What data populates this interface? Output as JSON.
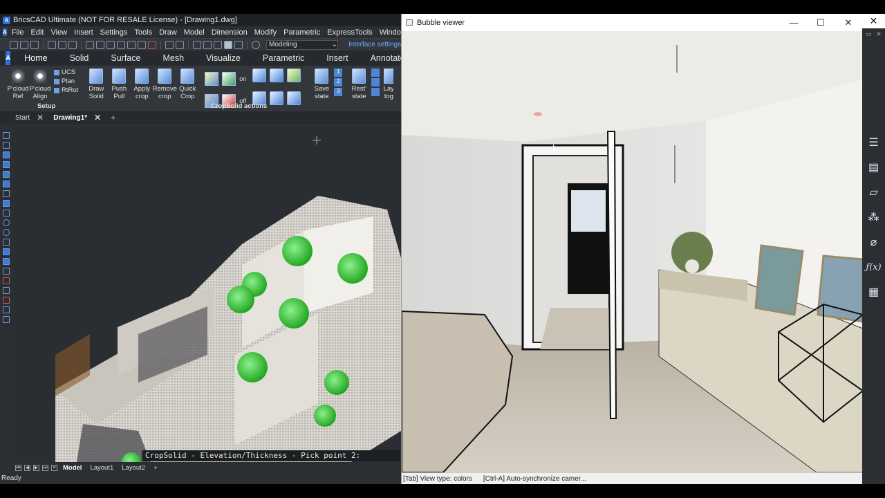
{
  "cad": {
    "title": "BricsCAD Ultimate (NOT FOR RESALE License) - [Drawing1.dwg]",
    "menu": [
      "File",
      "Edit",
      "View",
      "Insert",
      "Settings",
      "Tools",
      "Draw",
      "Model",
      "Dimension",
      "Modify",
      "Parametric",
      "ExpressTools",
      "Window"
    ],
    "workspace": "Modeling",
    "interface_settings": "Interface settings",
    "ribbon_tabs": [
      "Home",
      "Solid",
      "Surface",
      "Mesh",
      "Visualize",
      "Parametric",
      "Insert",
      "Annotate"
    ],
    "ribbon": {
      "pcloud_ref": "P'cloud\nRef",
      "pcloud_align": "P'cloud\nAlign",
      "ucs": "UCS",
      "plan": "Plan",
      "rtrot": "RtRot",
      "setup_label": "Setup",
      "draw_solid": "Draw\nSolid",
      "push_pull": "Push\nPull",
      "apply_crop": "Apply\ncrop",
      "remove_crop": "Remove\ncrop",
      "quick_crop": "Quick\nCrop",
      "on_label": "on",
      "off_label": "off",
      "save_state": "Save\nstate",
      "rest_state": "Rest'\nstate",
      "lay_tog": "Lay\ntog",
      "cropsolid_label": "CropSolid actions",
      "grid_nums": [
        "1",
        "2",
        "3"
      ]
    },
    "doc_tabs": [
      "Start",
      "Drawing1*"
    ],
    "command_line": "CropSolid - Elevation/Thickness - Pick point 2:",
    "layout_tabs": [
      "Model",
      "Layout1",
      "Layout2"
    ],
    "status": "Ready"
  },
  "bubble_viewer": {
    "title": "Bubble viewer",
    "status_left": "[Tab] View type: colors",
    "status_right": "[Ctrl-A] Auto-synchronize camer..."
  },
  "right_panel": {
    "close": "✕",
    "icons": [
      "sliders-icon",
      "layers-tree-icon",
      "stack-icon",
      "hierarchy-icon",
      "attachment-icon",
      "formula-icon",
      "grid-icon"
    ]
  }
}
